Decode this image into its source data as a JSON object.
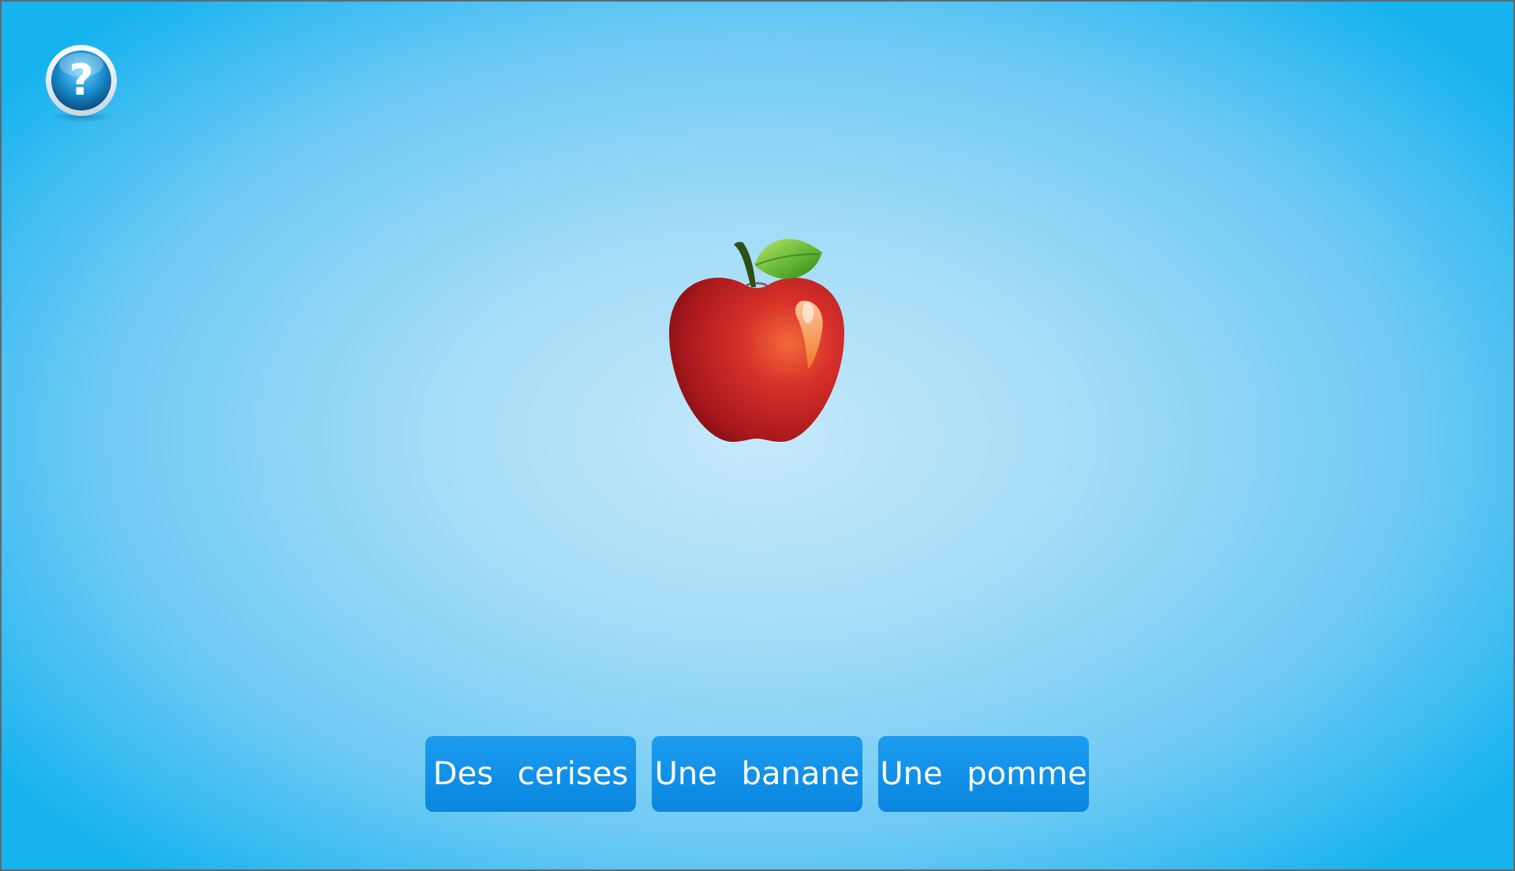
{
  "help": {
    "icon": "question-mark-icon",
    "glyph": "?"
  },
  "question": {
    "image": "apple-icon"
  },
  "answers": [
    {
      "label": "Des cerises"
    },
    {
      "label": "Une banane"
    },
    {
      "label": "Une pomme"
    }
  ],
  "colors": {
    "background_center": "#c6e9fb",
    "background_edge": "#17b3ef",
    "button": "#0a86e0",
    "button_text": "#ffffff"
  }
}
